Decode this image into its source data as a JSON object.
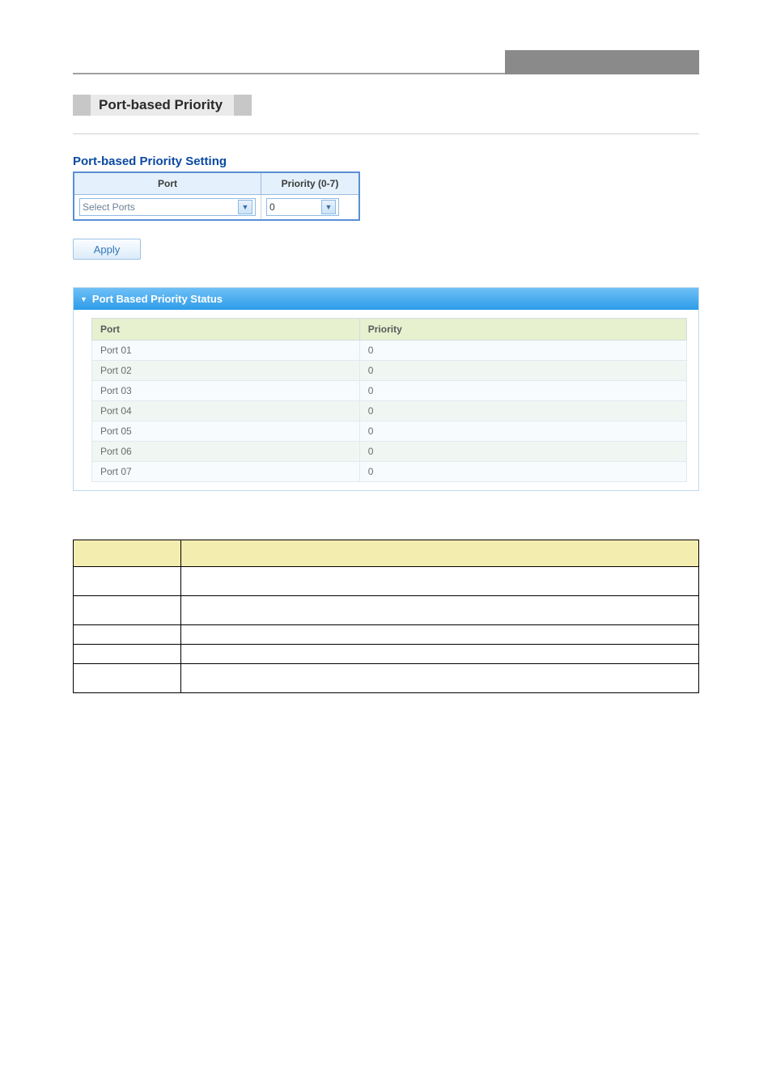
{
  "page_title_chip": "Port-based Priority",
  "setting": {
    "heading": "Port-based Priority Setting",
    "port_header": "Port",
    "priority_header": "Priority (0-7)",
    "port_select_placeholder": "Select Ports",
    "priority_value": "0",
    "apply_label": "Apply"
  },
  "status": {
    "panel_title": "Port Based Priority Status",
    "port_header": "Port",
    "priority_header": "Priority",
    "rows": [
      {
        "port": "Port 01",
        "priority": "0"
      },
      {
        "port": "Port 02",
        "priority": "0"
      },
      {
        "port": "Port 03",
        "priority": "0"
      },
      {
        "port": "Port 04",
        "priority": "0"
      },
      {
        "port": "Port 05",
        "priority": "0"
      },
      {
        "port": "Port 06",
        "priority": "0"
      },
      {
        "port": "Port 07",
        "priority": "0"
      }
    ]
  }
}
